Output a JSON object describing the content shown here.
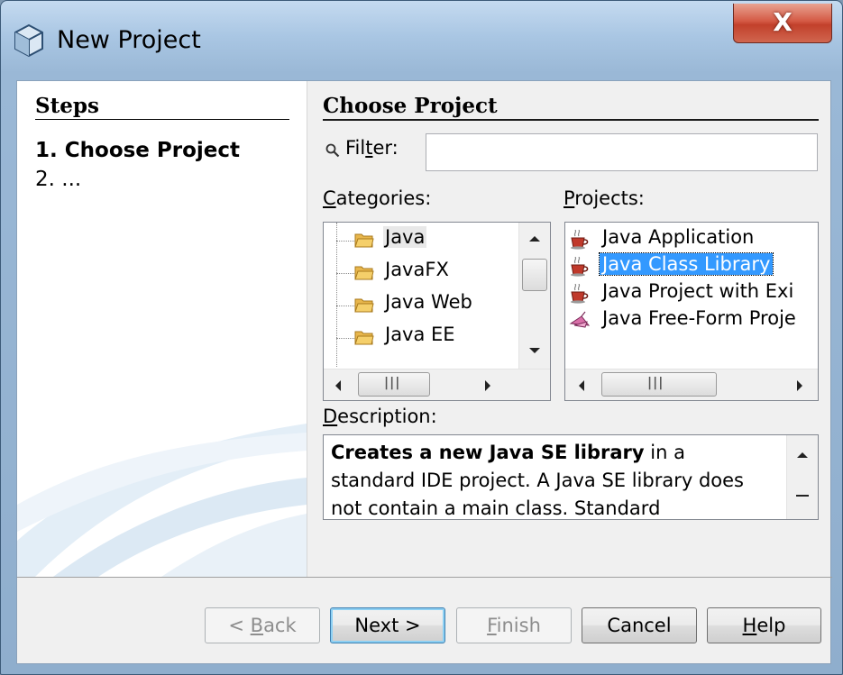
{
  "window": {
    "title": "New Project",
    "close_label": "X"
  },
  "steps": {
    "heading": "Steps",
    "items": [
      {
        "number": "1.",
        "label": "Choose Project"
      },
      {
        "number": "2.",
        "label": "..."
      }
    ]
  },
  "main": {
    "heading": "Choose Project",
    "filter": {
      "label_pre": "Fil",
      "label_mn": "t",
      "label_post": "er:",
      "value": ""
    },
    "categories": {
      "label_mn": "C",
      "label_rest": "ategories:",
      "items": [
        "Java",
        "JavaFX",
        "Java Web",
        "Java EE"
      ],
      "selected": "Java"
    },
    "projects": {
      "label_mn": "P",
      "label_rest": "rojects:",
      "items": [
        {
          "label": "Java Application",
          "icon": "coffee-cup-icon"
        },
        {
          "label": "Java Class Library",
          "icon": "coffee-cup-icon"
        },
        {
          "label": "Java Project with Exi",
          "icon": "coffee-cup-icon"
        },
        {
          "label": "Java Free-Form Proje",
          "icon": "ant-icon"
        }
      ],
      "selected": "Java Class Library"
    },
    "description": {
      "label_mn": "D",
      "label_rest": "escription:",
      "bold": "Creates a new Java SE library",
      "rest": " in a standard IDE project. A Java SE library does not contain a main class. Standard"
    }
  },
  "buttons": {
    "back": {
      "pre": "< ",
      "mn": "B",
      "post": "ack"
    },
    "next": "Next >",
    "finish": {
      "mn": "F",
      "post": "inish"
    },
    "cancel": "Cancel",
    "help": {
      "mn": "H",
      "post": "elp"
    }
  }
}
